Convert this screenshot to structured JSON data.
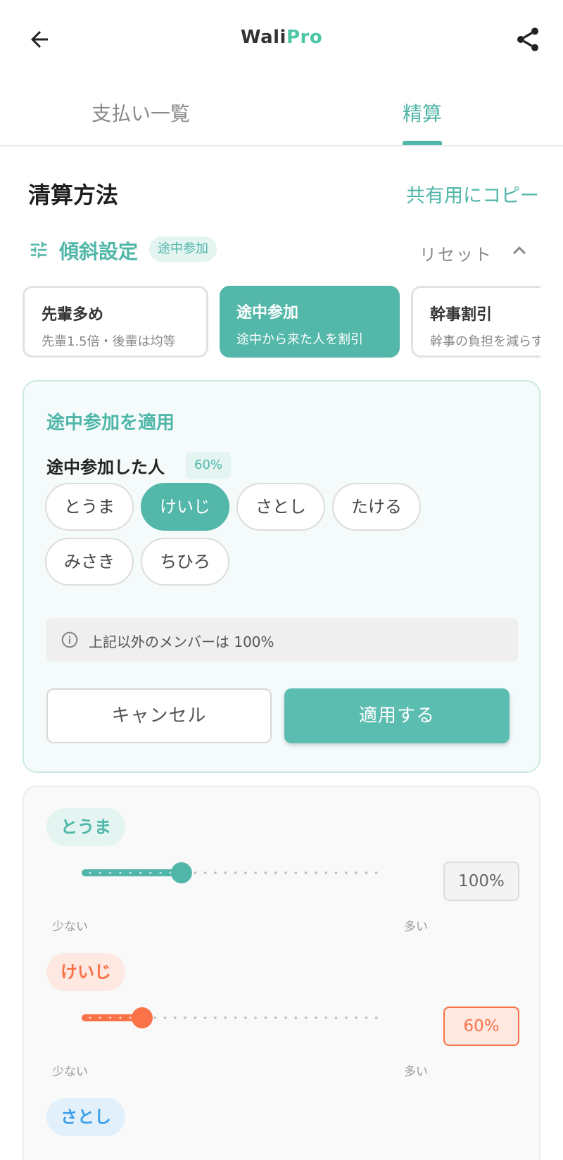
{
  "app": {
    "logo_part1": "Wali",
    "logo_part2": "Pro"
  },
  "tabs": [
    {
      "label": "支払い一覧",
      "active": false
    },
    {
      "label": "精算",
      "active": true
    }
  ],
  "section": {
    "title": "清算方法",
    "copy_link": "共有用にコピー"
  },
  "slope": {
    "label": "傾斜設定",
    "badge": "途中参加",
    "reset": "リセット"
  },
  "presets": [
    {
      "title": "先輩多め",
      "subtitle": "先輩1.5倍・後輩は均等",
      "selected": false
    },
    {
      "title": "途中参加",
      "subtitle": "途中から来た人を割引",
      "selected": true
    },
    {
      "title": "幹事割引",
      "subtitle": "幹事の負担を減らす",
      "selected": false
    }
  ],
  "apply_panel": {
    "title": "途中参加を適用",
    "who_label": "途中参加した人",
    "who_badge": "60%",
    "chips": [
      {
        "label": "とうま",
        "selected": false
      },
      {
        "label": "けいじ",
        "selected": true
      },
      {
        "label": "さとし",
        "selected": false
      },
      {
        "label": "たける",
        "selected": false
      },
      {
        "label": "みさき",
        "selected": false
      },
      {
        "label": "ちひろ",
        "selected": false
      }
    ],
    "note": "上記以外のメンバーは 100%",
    "cancel": "キャンセル",
    "apply": "適用する"
  },
  "members": [
    {
      "name": "とうま",
      "value": "100%",
      "level": 0.33,
      "color": "#4fb6a8",
      "pill_bg": "#e3f4f1",
      "box_border": "#dcdcdc",
      "box_bg": "#f3f3f3",
      "box_text": "#666666",
      "min_label": "少ない",
      "max_label": "多い"
    },
    {
      "name": "けいじ",
      "value": "60%",
      "level": 0.2,
      "color": "#fa7248",
      "pill_bg": "#fde9e2",
      "box_border": "#fa7248",
      "box_bg": "#fde9e2",
      "box_text": "#fa7248",
      "min_label": "少ない",
      "max_label": "多い"
    },
    {
      "name": "さとし",
      "color": "#3f9fe6",
      "pill_bg": "#e2f0fb"
    }
  ]
}
